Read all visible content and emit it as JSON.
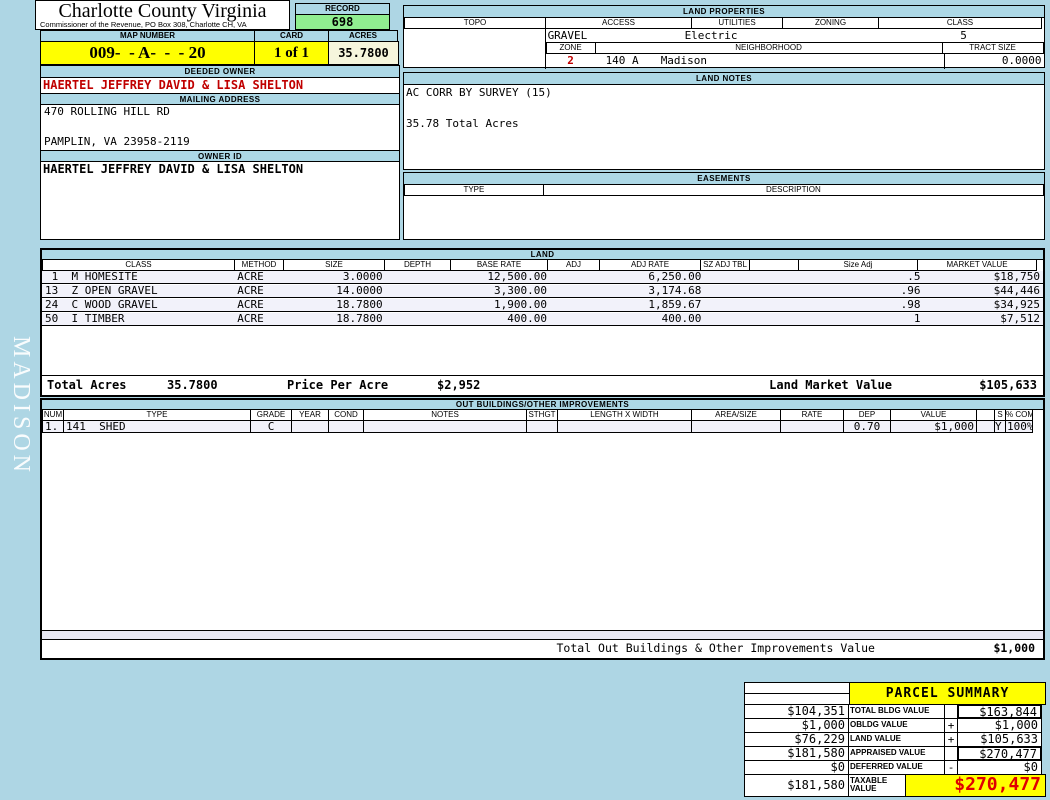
{
  "page": {
    "watermark": "MADISON",
    "title": "Charlotte County Virginia",
    "subtitle": "Commissioner of the Revenue, PO Box 308, Charlotte CH, VA"
  },
  "record": {
    "label": "RECORD",
    "value": "698"
  },
  "map": {
    "map_number_label": "MAP NUMBER",
    "map_number": "009-  - A-  -  - 20",
    "card_label": "CARD",
    "card": "1 of 1",
    "acres_label": "ACRES",
    "acres": "35.7800"
  },
  "owner": {
    "deeded_owner_label": "DEEDED OWNER",
    "deeded_owner": "HAERTEL JEFFREY DAVID & LISA SHELTON",
    "mailing_address_label": "MAILING ADDRESS",
    "address_line1": "470 ROLLING HILL RD",
    "address_line2": "PAMPLIN, VA 23958-2119",
    "owner_id_label": "OWNER ID",
    "owner_id": "HAERTEL JEFFREY DAVID & LISA SHELTON"
  },
  "land_properties": {
    "title": "LAND PROPERTIES",
    "topo_label": "TOPO",
    "topo": "",
    "access_label": "ACCESS",
    "access": "GRAVEL",
    "utilities_label": "UTILITIES",
    "utilities": "Electric",
    "zoning_label": "ZONING",
    "zoning": "",
    "class_label": "CLASS",
    "class": "5",
    "zone_label": "ZONE",
    "zone": "2",
    "neighborhood_label": "NEIGHBORHOOD",
    "neighborhood_code": "140 A",
    "neighborhood": "Madison",
    "tract_size_label": "TRACT SIZE",
    "tract_size": "0.0000"
  },
  "land_notes": {
    "title": "LAND NOTES",
    "line1": "AC CORR BY SURVEY (15)",
    "line2": "35.78 Total Acres"
  },
  "easements": {
    "title": "EASEMENTS",
    "type_label": "TYPE",
    "description_label": "DESCRIPTION"
  },
  "land": {
    "title": "LAND",
    "headers": [
      "CLASS",
      "METHOD",
      "SIZE",
      "DEPTH",
      "BASE RATE",
      "ADJ",
      "ADJ RATE",
      "SZ ADJ TBL",
      "",
      "Size Adj",
      "MARKET VALUE"
    ],
    "rows": [
      {
        "class": " 1  M HOMESITE",
        "method": "ACRE",
        "size": "3.0000",
        "depth": "",
        "base_rate": "12,500.00",
        "adj": "",
        "adj_rate": "6,250.00",
        "sz_adj_tbl": "",
        "size_adj": ".5",
        "market_value": "$18,750"
      },
      {
        "class": "13  Z OPEN GRAVEL",
        "method": "ACRE",
        "size": "14.0000",
        "depth": "",
        "base_rate": "3,300.00",
        "adj": "",
        "adj_rate": "3,174.68",
        "sz_adj_tbl": "",
        "size_adj": ".96",
        "market_value": "$44,446"
      },
      {
        "class": "24  C WOOD GRAVEL",
        "method": "ACRE",
        "size": "18.7800",
        "depth": "",
        "base_rate": "1,900.00",
        "adj": "",
        "adj_rate": "1,859.67",
        "sz_adj_tbl": "",
        "size_adj": ".98",
        "market_value": "$34,925"
      },
      {
        "class": "50  I TIMBER",
        "method": "ACRE",
        "size": "18.7800",
        "depth": "",
        "base_rate": "400.00",
        "adj": "",
        "adj_rate": "400.00",
        "sz_adj_tbl": "",
        "size_adj": "1",
        "market_value": "$7,512"
      }
    ],
    "totals": {
      "total_acres_label": "Total Acres",
      "total_acres": "35.7800",
      "price_per_acre_label": "Price Per Acre",
      "price_per_acre": "$2,952",
      "land_market_value_label": "Land Market Value",
      "land_market_value": "$105,633"
    }
  },
  "out_buildings": {
    "title": "OUT BUILDINGS/OTHER IMPROVEMENTS",
    "headers": [
      "NUM",
      "TYPE",
      "GRADE",
      "YEAR",
      "COND",
      "NOTES",
      "STHGT",
      "LENGTH X WIDTH",
      "AREA/SIZE",
      "RATE",
      "DEP",
      "VALUE",
      "",
      "S",
      "% COMP"
    ],
    "rows": [
      {
        "num": "1.",
        "type": "141  SHED",
        "grade": "C",
        "year": "",
        "cond": "",
        "notes": "",
        "sthgt": "",
        "length_width": "",
        "area_size": "",
        "rate": "",
        "dep": "0.70",
        "value": "$1,000",
        "s": "Y",
        "pct_comp": "100%"
      }
    ],
    "total_label": "Total Out Buildings & Other Improvements Value",
    "total_value": "$1,000"
  },
  "parcel_summary": {
    "title": "PARCEL SUMMARY",
    "rows": [
      {
        "left": "$104,351",
        "label": "TOTAL BLDG VALUE",
        "sign": "",
        "right": "$163,844"
      },
      {
        "left": "$1,000",
        "label": "OBLDG VALUE",
        "sign": "+",
        "right": "$1,000"
      },
      {
        "left": "$76,229",
        "label": "LAND VALUE",
        "sign": "+",
        "right": "$105,633"
      },
      {
        "left": "$181,580",
        "label": "APPRAISED VALUE",
        "sign": "",
        "right": "$270,477"
      },
      {
        "left": "$0",
        "label": "DEFERRED VALUE",
        "sign": "-",
        "right": "$0"
      }
    ],
    "taxable": {
      "left": "$181,580",
      "label": "TAXABLE VALUE",
      "value": "$270,477"
    }
  }
}
